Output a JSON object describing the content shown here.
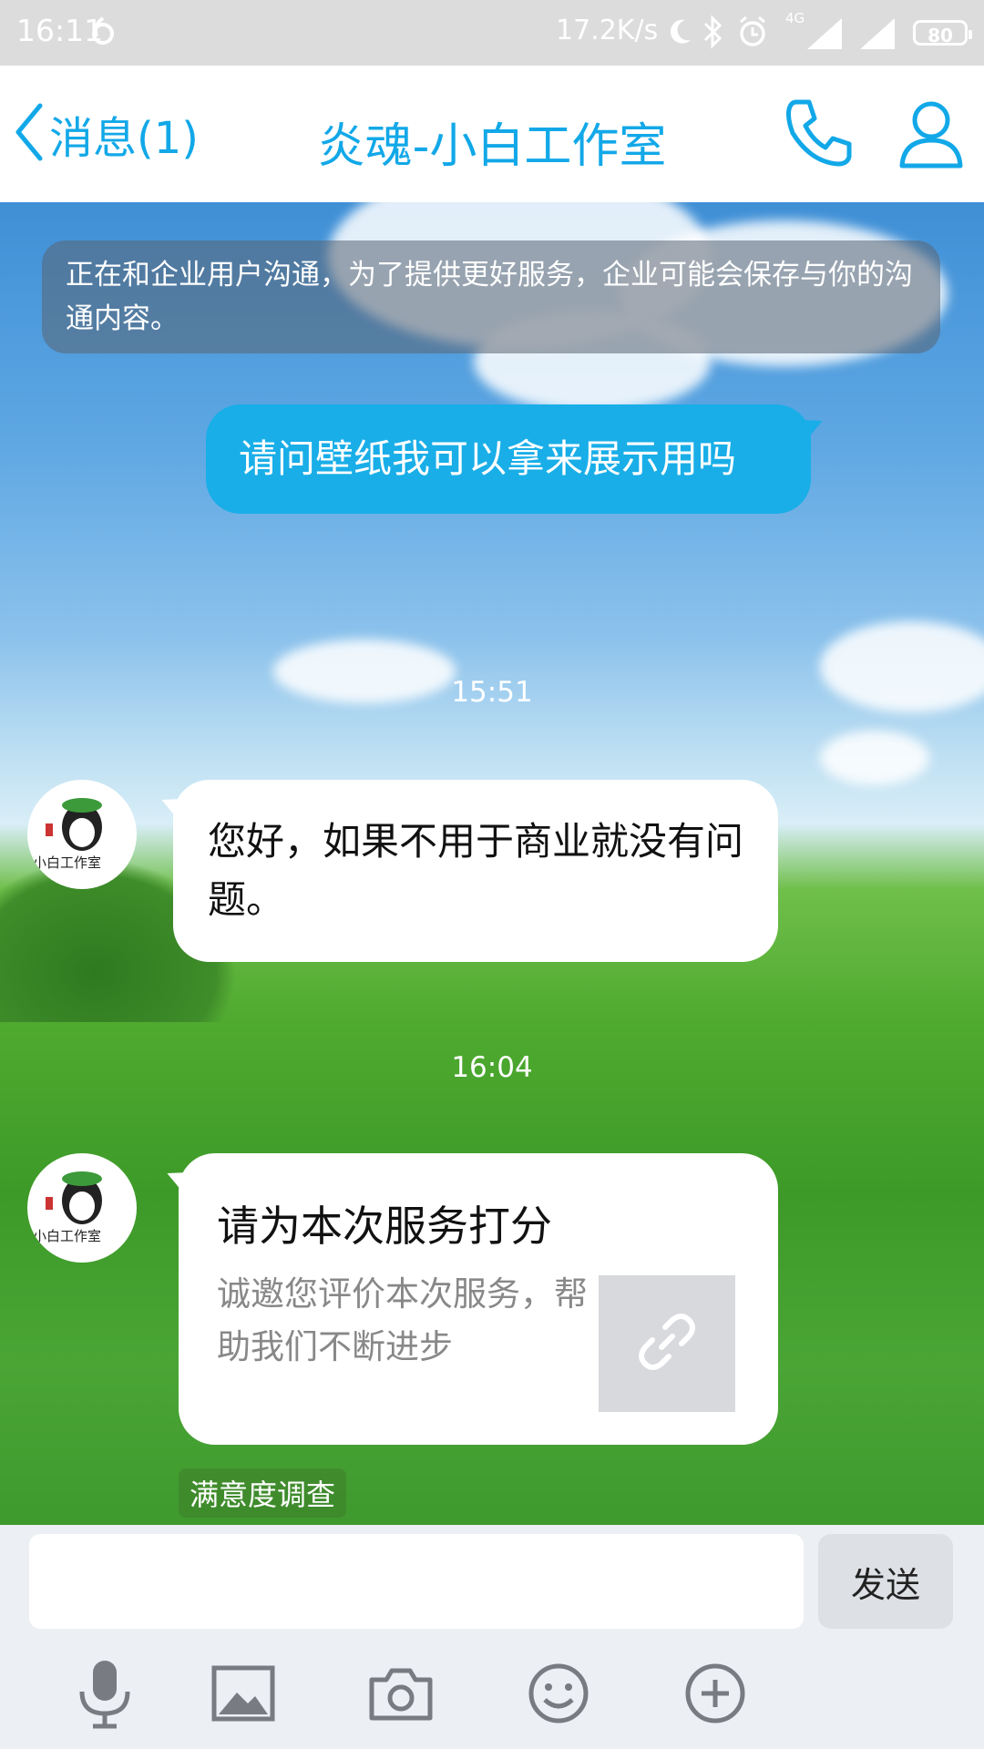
{
  "status_bar": {
    "time": "16:11",
    "network_speed": "17.2K/s",
    "network_type": "4G",
    "battery": "80"
  },
  "nav": {
    "back_label": "消息(1)",
    "title": "炎魂-小白工作室",
    "icons": [
      "phone-icon",
      "profile-icon"
    ],
    "accent_color": "#12a8e8"
  },
  "chat": {
    "notice": "正在和企业用户沟通，为了提供更好服务，企业可能会保存与你的沟通内容。",
    "messages": [
      {
        "from": "me",
        "text": "请问壁纸我可以拿来展示用吗"
      },
      {
        "time": "15:51"
      },
      {
        "from": "them",
        "text": "您好，如果不用于商业就没有问题。"
      },
      {
        "time": "16:04"
      },
      {
        "from": "them",
        "type": "card",
        "title": "请为本次服务打分",
        "description": "诚邀您评价本次服务，帮助我们不断进步",
        "source": "满意度调查"
      }
    ],
    "avatar_text": "小白工作室",
    "bubble_color_me": "#19aee8"
  },
  "composer": {
    "input_value": "",
    "send_label": "发送",
    "tools": [
      "microphone-icon",
      "image-icon",
      "camera-icon",
      "emoji-icon",
      "plus-icon"
    ]
  }
}
